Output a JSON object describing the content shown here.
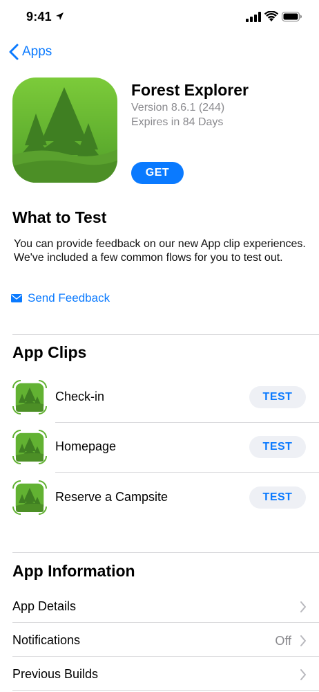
{
  "status_bar": {
    "time": "9:41",
    "icons": [
      "location-arrow-icon",
      "signal-icon",
      "wifi-icon",
      "battery-icon"
    ]
  },
  "nav": {
    "back_label": "Apps",
    "back_icon": "chevron-left-icon"
  },
  "app": {
    "name": "Forest Explorer",
    "version": "Version 8.6.1 (244)",
    "expires": "Expires in 84 Days",
    "get_label": "GET",
    "icon": "forest-trees-icon"
  },
  "what_to_test": {
    "title": "What to Test",
    "body": "You can provide feedback on our new App clip experiences. We've included a few common flows for you to test out.",
    "feedback_label": "Send Feedback",
    "feedback_icon": "mail-icon"
  },
  "app_clips": {
    "title": "App Clips",
    "items": [
      {
        "label": "Check-in",
        "button": "TEST"
      },
      {
        "label": "Homepage",
        "button": "TEST"
      },
      {
        "label": "Reserve a Campsite",
        "button": "TEST"
      }
    ]
  },
  "app_information": {
    "title": "App Information",
    "rows": [
      {
        "label": "App Details",
        "value": ""
      },
      {
        "label": "Notifications",
        "value": "Off"
      },
      {
        "label": "Previous Builds",
        "value": ""
      }
    ]
  },
  "colors": {
    "accent": "#0a7aff",
    "secondary_text": "#8a8a8e",
    "pill_background": "#eef0f5",
    "icon_green": "#5fb12f"
  }
}
